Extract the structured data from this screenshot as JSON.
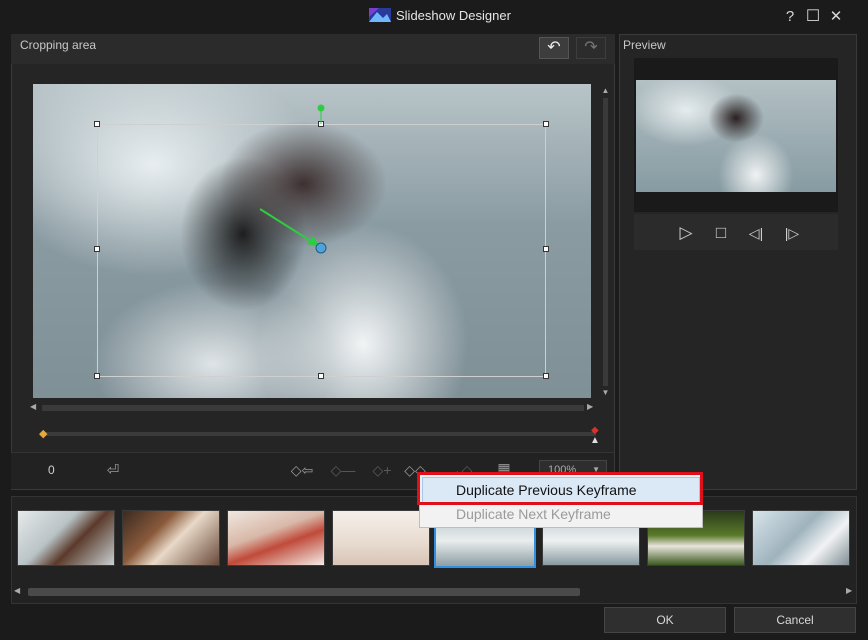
{
  "window": {
    "title": "Slideshow Designer",
    "help": "?",
    "maximize": "☐",
    "close": "✕"
  },
  "cropping": {
    "label": "Cropping area",
    "undo_icon": "↶",
    "redo_icon": "↷",
    "keyframe_time": "0",
    "zoom_value": "100%",
    "toolbar_icons": [
      "◇⇦",
      "◇—",
      "◇+",
      "◇◇",
      "→◇",
      "▦"
    ]
  },
  "preview": {
    "label": "Preview",
    "controls": [
      "▷",
      "□",
      "◁|",
      "|▷"
    ]
  },
  "context_menu": {
    "items": [
      {
        "label": "Duplicate Previous Keyframe",
        "enabled": true
      },
      {
        "label": "Duplicate Next Keyframe",
        "enabled": false
      }
    ]
  },
  "filmstrip": {
    "selected_index": 4,
    "count": 8
  },
  "footer": {
    "ok": "OK",
    "cancel": "Cancel"
  },
  "colors": {
    "accent_selection": "#2f8fe0",
    "highlight_red": "#e0101a",
    "keyframe_red": "#d9322a",
    "keyframe_orange": "#e7a73a"
  },
  "icons": {
    "app": "slideshow-designer-logo",
    "undo": "undo-icon",
    "redo": "redo-icon"
  }
}
